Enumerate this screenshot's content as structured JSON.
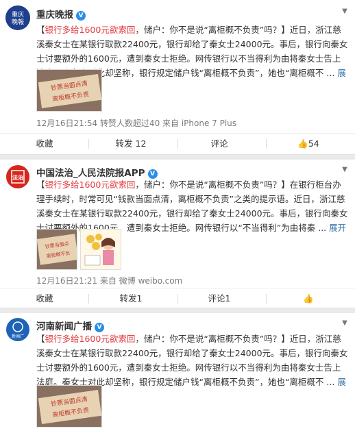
{
  "posts": [
    {
      "author": "重庆晚报",
      "verified": "V",
      "text_prefix": "【",
      "text_highlight": "银行多给1600元欲索回",
      "text_body": "，储户：你不是说“离柜概不负责”吗？】近日，浙江慈溪秦女士在某银行取款22400元，银行却给了秦女士24000元。事后，银行向秦女士讨要额外的1600元，遭到秦女士拒绝。网传银行以不当得利为由将秦女士告上法庭。秦女士对此却坚称，银行规定储户钱“离柜概不负责”，她也“离柜概不 ...",
      "expand_label": "展开全文",
      "expand_icon": "chevron-down-icon",
      "meta": "12月16日21:54 转赞人数超过40 来自 iPhone 7 Plus",
      "actions": {
        "favorite": "收藏",
        "repost": "转发 12",
        "comment": "评论",
        "like": "54"
      }
    },
    {
      "author": "中国法治_人民法院报APP",
      "verified": "V",
      "text_prefix": "【",
      "text_highlight": "银行多给1600元欲索回",
      "text_body": "，储户：你不是说“离柜概不负责”吗？】在银行柜台办理手续时，时常可见“钱款当面点清，离柜概不负责”之类的提示语。近日，浙江慈溪秦女士在某银行取款22400元，银行却给了秦女士24000元。事后，银行向秦女士讨要额外的1600元，遭到秦女士拒绝。网传银行以“不当得利”为由将秦 ...",
      "expand_label": "展开全文",
      "expand_icon": "chevron-down-icon",
      "meta": "12月16日21:21 来自 微博 weibo.com",
      "actions": {
        "favorite": "收藏",
        "repost": "转发1",
        "comment": "评论1",
        "like": ""
      }
    },
    {
      "author": "河南新闻广播",
      "verified": "V",
      "text_prefix": "【",
      "text_highlight": "银行多给1600元欲索回",
      "text_body": "，储户：你不是说“离柜概不负责”吗？】近日，浙江慈溪秦女士在某银行取款22400元，银行却给了秦女士24000元。事后，银行向秦女士讨要额外的1600元，遭到秦女士拒绝。网传银行以不当得利为由将秦女士告上法庭。秦女士对此却坚称，银行规定储户钱“离柜概不负责”，她也“离柜概不 ...",
      "expand_label": "展开全文",
      "expand_icon": "chevron-down-icon",
      "meta": "",
      "actions": {}
    }
  ],
  "sign_text": "钞票当面点清 离柜概不负责",
  "logo_text": {
    "p1": "重庆晚报",
    "p2": "法治",
    "p3": "河南新闻广播"
  },
  "colors": {
    "highlight": "#e4393c",
    "link": "#3b73a6",
    "verified": "#2b8fe8",
    "meta": "#7a7a7a"
  }
}
